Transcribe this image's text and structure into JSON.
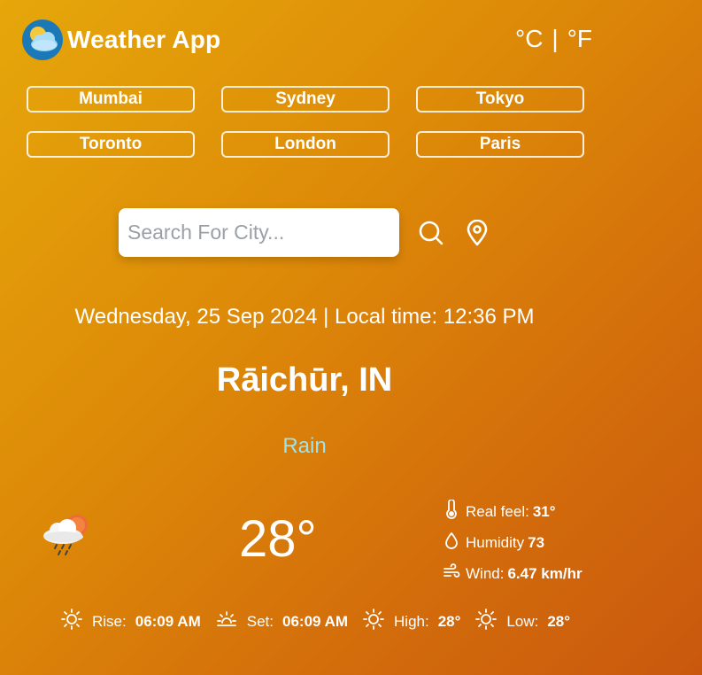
{
  "header": {
    "title": "Weather App",
    "logo_icon": "weather-logo-icon"
  },
  "units": {
    "celsius": "°C",
    "separator": "|",
    "fahrenheit": "°F"
  },
  "cities": [
    "Mumbai",
    "Sydney",
    "Tokyo",
    "Toronto",
    "London",
    "Paris"
  ],
  "search": {
    "placeholder": "Search For City..."
  },
  "location": {
    "datetime": "Wednesday, 25 Sep 2024 | Local time: 12:36 PM",
    "city": "Rāichūr, IN",
    "condition": "Rain"
  },
  "current": {
    "temperature": "28°",
    "icon": "rain-cloud-icon",
    "details": {
      "real_feel_label": "Real feel:",
      "real_feel": "31°",
      "humidity_label": "Humidity",
      "humidity": "73",
      "wind_label": "Wind:",
      "wind": "6.47 km/hr"
    }
  },
  "sun": {
    "rise_label": "Rise:",
    "rise": "06:09 AM",
    "set_label": "Set:",
    "set": "06:09 AM",
    "high_label": "High:",
    "high": "28°",
    "low_label": "Low:",
    "low": "28°"
  },
  "colors": {
    "condition": "#9fe3ea",
    "gradient_start": "#e6a70a",
    "gradient_end": "#c9580e"
  }
}
